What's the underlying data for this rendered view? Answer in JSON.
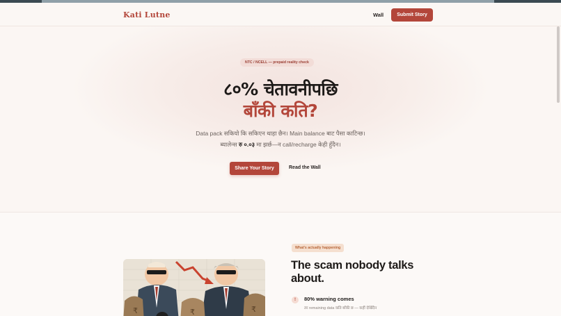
{
  "nav": {
    "brand": "Kati Lutne",
    "wall_link": "Wall",
    "submit_button": "Submit Story"
  },
  "hero": {
    "pill": "NTC / NCELL — prepaid reality check",
    "title_line1": "८०% चेतावनीपछि",
    "title_line2": "बाँकी कति?",
    "subtitle_line1": "Data pack सकियो कि सकिएन थाहा छैन। Main balance बाट पैसा काटिन्छ।",
    "subtitle_line2_before": "ब्यालेन्स ",
    "subtitle_line2_bold": "रु ०.०३",
    "subtitle_line2_after": " मा झर्छ—न call/recharge केही हुँदैन।",
    "share_button": "Share Your Story",
    "read_link": "Read the Wall"
  },
  "section": {
    "tag": "What's actually happening",
    "heading": "The scam nobody talks about.",
    "feature": {
      "icon_text": "!",
      "title": "80% warning comes",
      "description": "तर remaining data कति बाँकी छ — कहीं देखिँदैन"
    }
  },
  "colors": {
    "accent": "#b3463a",
    "background": "#fbf7f4",
    "text": "#1d1a18"
  }
}
